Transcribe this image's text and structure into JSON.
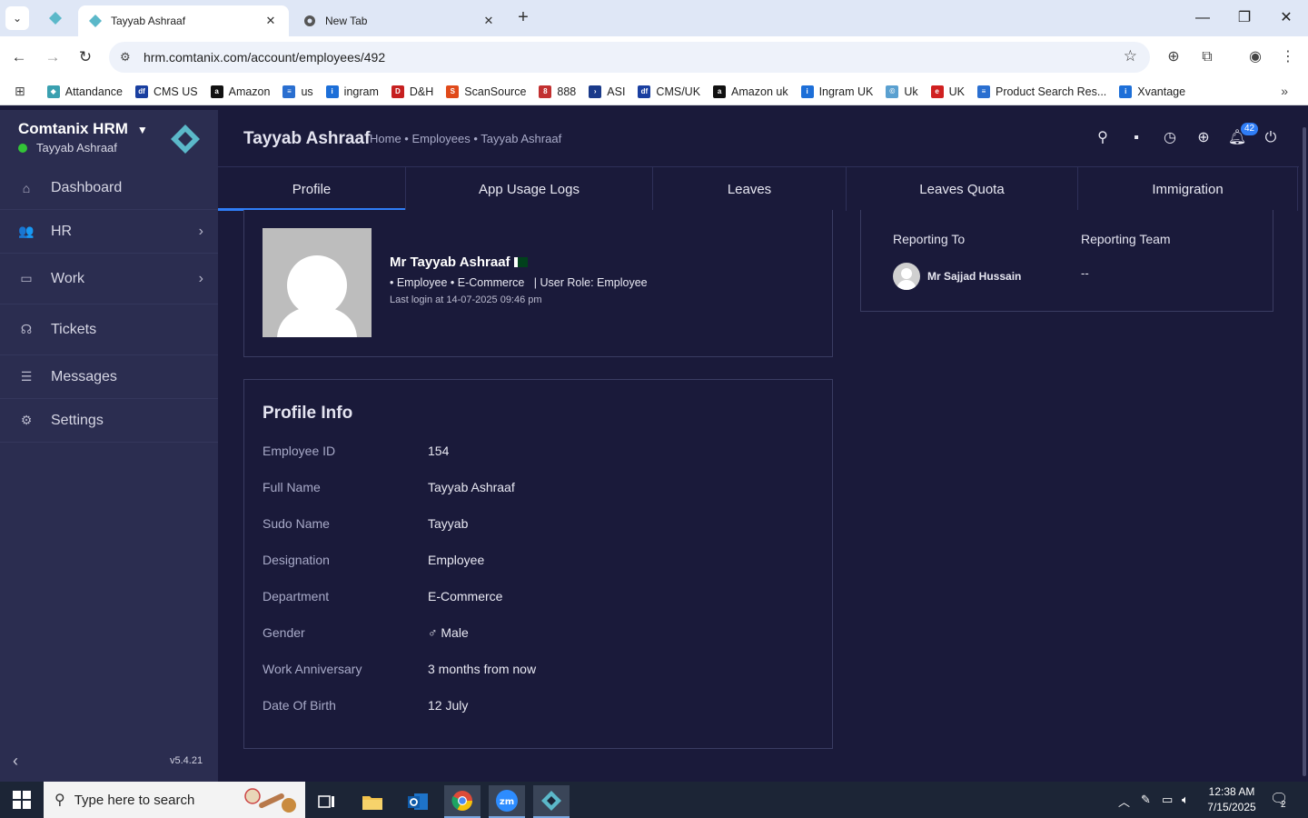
{
  "browser": {
    "tabs": [
      {
        "title": "Tayyab Ashraaf",
        "active": true
      },
      {
        "title": "New Tab",
        "active": false
      }
    ],
    "url": "hrm.comtanix.com/account/employees/492",
    "bookmarks": [
      "Attandance",
      "CMS US",
      "Amazon",
      "us",
      "ingram",
      "D&H",
      "ScanSource",
      "888",
      "ASI",
      "CMS/UK",
      "Amazon uk",
      "Ingram UK",
      "Uk",
      "UK",
      "Product Search Res...",
      "Xvantage"
    ]
  },
  "sidebar": {
    "brand": "Comtanix HRM",
    "user": "Tayyab Ashraaf",
    "items": [
      {
        "label": "Dashboard",
        "icon": "home-icon"
      },
      {
        "label": "HR",
        "icon": "users-icon"
      },
      {
        "label": "Work",
        "icon": "briefcase-icon"
      },
      {
        "label": "Tickets",
        "icon": "headset-icon"
      },
      {
        "label": "Messages",
        "icon": "message-icon"
      },
      {
        "label": "Settings",
        "icon": "gear-icon"
      }
    ],
    "version": "v5.4.21"
  },
  "header": {
    "title": "Tayyab Ashraaf",
    "breadcrumb": "Home • Employees • Tayyab Ashraaf",
    "notification_count": "42"
  },
  "tabs": [
    "Profile",
    "App Usage Logs",
    "Leaves",
    "Leaves Quota",
    "Immigration"
  ],
  "profile": {
    "name": "Mr Tayyab Ashraaf",
    "meta": "• Employee • E-Commerce   | User Role: Employee",
    "last_login": "Last login at 14-07-2025 09:46 pm"
  },
  "profile_info": {
    "title": "Profile Info",
    "rows": [
      {
        "label": "Employee ID",
        "value": "154"
      },
      {
        "label": "Full Name",
        "value": "Tayyab Ashraaf"
      },
      {
        "label": "Sudo Name",
        "value": "Tayyab"
      },
      {
        "label": "Designation",
        "value": "Employee"
      },
      {
        "label": "Department",
        "value": "E-Commerce"
      },
      {
        "label": "Gender",
        "value": "♂ Male"
      },
      {
        "label": "Work Anniversary",
        "value": "3 months from now"
      },
      {
        "label": "Date Of Birth",
        "value": "12 July"
      }
    ]
  },
  "reporting": {
    "to_label": "Reporting To",
    "team_label": "Reporting Team",
    "to_name": "Mr Sajjad Hussain",
    "team_value": "--"
  },
  "taskbar": {
    "search_placeholder": "Type here to search",
    "time": "12:38 AM",
    "date": "7/15/2025",
    "notif_count": "2"
  }
}
